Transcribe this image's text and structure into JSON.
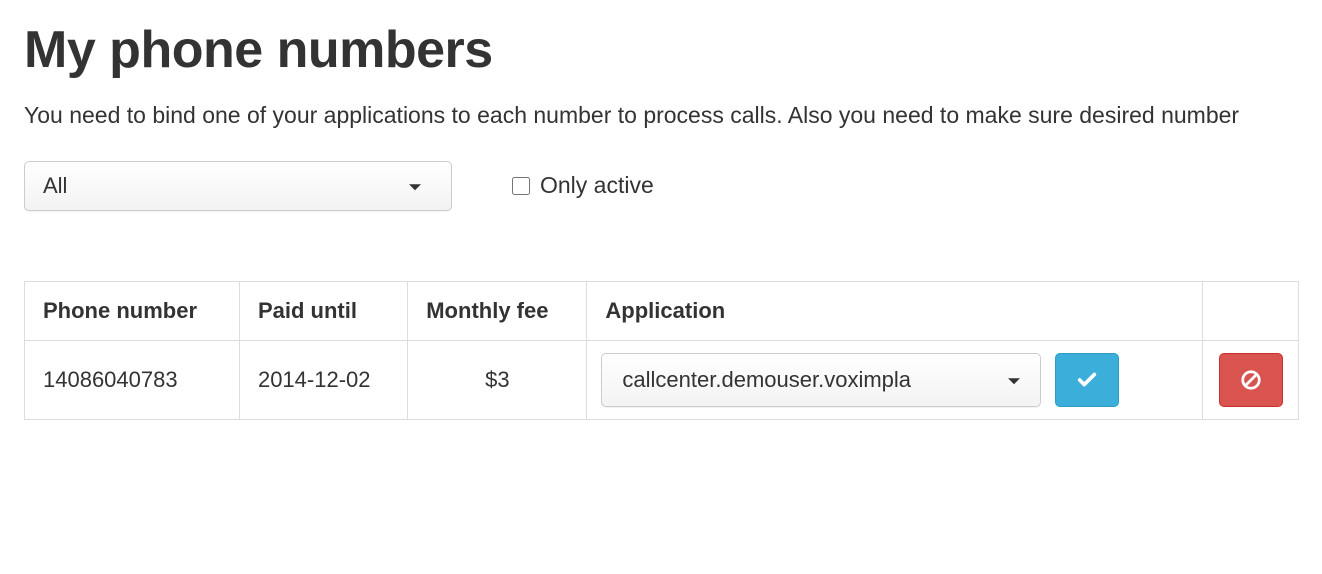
{
  "header": {
    "title": "My phone numbers",
    "description": "You need to bind one of your applications to each number to process calls. Also you need to make sure desired number"
  },
  "filters": {
    "dropdown_selected": "All",
    "only_active_label": "Only active"
  },
  "table": {
    "headers": {
      "phone_number": "Phone number",
      "paid_until": "Paid until",
      "monthly_fee": "Monthly fee",
      "application": "Application"
    },
    "rows": [
      {
        "phone_number": "14086040783",
        "paid_until": "2014-12-02",
        "monthly_fee": "$3",
        "application_selected": "callcenter.demouser.voximpla"
      }
    ]
  }
}
